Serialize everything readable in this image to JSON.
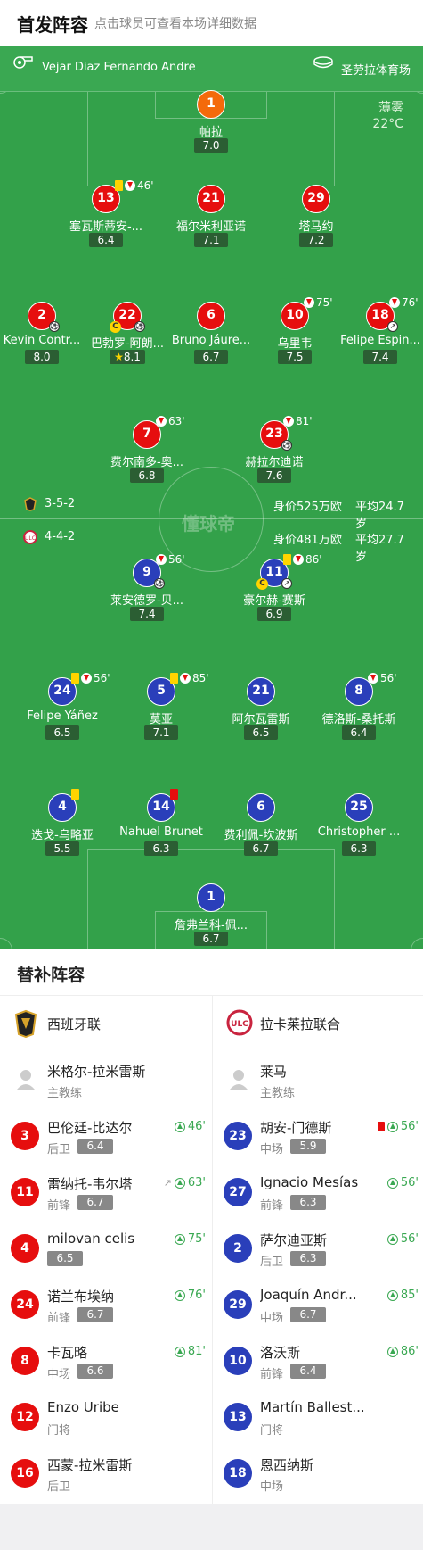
{
  "header": {
    "title": "首发阵容",
    "subtitle": "点击球员可查看本场详细数据"
  },
  "match_info": {
    "referee": "Vejar Diaz Fernando Andre",
    "stadium": "圣劳拉体育场",
    "weather": "薄雾",
    "temperature": "22°C"
  },
  "home": {
    "formation": "3-5-2",
    "value": "身价525万欧",
    "avg_age": "平均24.7岁",
    "color": "#e60e0e"
  },
  "away": {
    "formation": "4-4-2",
    "value": "身价481万欧",
    "avg_age": "平均27.7岁",
    "color": "#2a3fba"
  },
  "watermark": "懂球帝",
  "home_players": [
    {
      "num": "1",
      "name": "帕拉",
      "rating": "7.0",
      "gk": true
    },
    {
      "num": "13",
      "name": "塞瓦斯蒂安-...",
      "rating": "6.4",
      "yellow": true,
      "sub_off": "46'"
    },
    {
      "num": "21",
      "name": "福尔米利亚诺",
      "rating": "7.1"
    },
    {
      "num": "29",
      "name": "塔马约",
      "rating": "7.2"
    },
    {
      "num": "2",
      "name": "Kevin Contr...",
      "rating": "8.0",
      "goal": true
    },
    {
      "num": "22",
      "name": "巴勃罗-阿朗...",
      "rating": "8.1",
      "captain": true,
      "goal": true,
      "star": true
    },
    {
      "num": "6",
      "name": "Bruno Jáure...",
      "rating": "6.7"
    },
    {
      "num": "10",
      "name": "乌里韦",
      "rating": "7.5",
      "sub_off": "75'"
    },
    {
      "num": "18",
      "name": "Felipe Espin...",
      "rating": "7.4",
      "sub_off": "76'",
      "assist": true
    },
    {
      "num": "7",
      "name": "费尔南多-奥...",
      "rating": "6.8",
      "sub_off": "63'"
    },
    {
      "num": "23",
      "name": "赫拉尔迪诺",
      "rating": "7.6",
      "sub_off": "81'",
      "goal": true
    }
  ],
  "away_players": [
    {
      "num": "9",
      "name": "莱安德罗-贝...",
      "rating": "7.4",
      "sub_off": "56'",
      "goal": true
    },
    {
      "num": "11",
      "name": "豪尔赫-赛斯",
      "rating": "6.9",
      "yellow": true,
      "sub_off": "86'",
      "captain": true,
      "assist": true
    },
    {
      "num": "24",
      "name": "Felipe Yáñez",
      "rating": "6.5",
      "yellow": true,
      "sub_off": "56'"
    },
    {
      "num": "5",
      "name": "莫亚",
      "rating": "7.1",
      "yellow": true,
      "sub_off": "85'"
    },
    {
      "num": "21",
      "name": "阿尔瓦雷斯",
      "rating": "6.5"
    },
    {
      "num": "8",
      "name": "德洛斯-桑托斯",
      "rating": "6.4",
      "sub_off": "56'"
    },
    {
      "num": "4",
      "name": "迭戈-乌略亚",
      "rating": "5.5",
      "yellow": true
    },
    {
      "num": "14",
      "name": "Nahuel Brunet",
      "rating": "6.3",
      "red": true
    },
    {
      "num": "6",
      "name": "费利佩-坎波斯",
      "rating": "6.7"
    },
    {
      "num": "25",
      "name": "Christopher ...",
      "rating": "6.3"
    },
    {
      "num": "1",
      "name": "詹弗兰科-佩...",
      "rating": "6.7",
      "gk": true
    }
  ],
  "subs_title": "替补阵容",
  "subs": {
    "home": {
      "team": "西班牙联",
      "coach": {
        "name": "米格尔-拉米雷斯",
        "role": "主教练"
      },
      "players": [
        {
          "num": "3",
          "name": "巴伦廷-比达尔",
          "pos": "后卫",
          "rating": "6.4",
          "sub_on": "46'"
        },
        {
          "num": "11",
          "name": "雷纳托-韦尔塔",
          "pos": "前锋",
          "rating": "6.7",
          "sub_on": "63'",
          "assist": true
        },
        {
          "num": "4",
          "name": "milovan celis",
          "pos": "",
          "rating": "6.5",
          "sub_on": "75'"
        },
        {
          "num": "24",
          "name": "诺兰布埃纳",
          "pos": "前锋",
          "rating": "6.7",
          "sub_on": "76'"
        },
        {
          "num": "8",
          "name": "卡瓦略",
          "pos": "中场",
          "rating": "6.6",
          "sub_on": "81'"
        },
        {
          "num": "12",
          "name": "Enzo Uribe",
          "pos": "门将",
          "rating": ""
        },
        {
          "num": "16",
          "name": "西蒙-拉米雷斯",
          "pos": "后卫",
          "rating": ""
        }
      ]
    },
    "away": {
      "team": "拉卡莱拉联合",
      "coach": {
        "name": "莱马",
        "role": "主教练"
      },
      "players": [
        {
          "num": "23",
          "name": "胡安-门德斯",
          "pos": "中场",
          "rating": "5.9",
          "sub_on": "56'",
          "red": true
        },
        {
          "num": "27",
          "name": "Ignacio Mesías",
          "pos": "前锋",
          "rating": "6.3",
          "sub_on": "56'"
        },
        {
          "num": "2",
          "name": "萨尔迪亚斯",
          "pos": "后卫",
          "rating": "6.3",
          "sub_on": "56'"
        },
        {
          "num": "29",
          "name": "Joaquín Andr...",
          "pos": "中场",
          "rating": "6.7",
          "sub_on": "85'"
        },
        {
          "num": "10",
          "name": "洛沃斯",
          "pos": "前锋",
          "rating": "6.4",
          "sub_on": "86'"
        },
        {
          "num": "13",
          "name": "Martín Ballest...",
          "pos": "门将",
          "rating": ""
        },
        {
          "num": "18",
          "name": "恩西纳斯",
          "pos": "中场",
          "rating": ""
        }
      ]
    }
  }
}
